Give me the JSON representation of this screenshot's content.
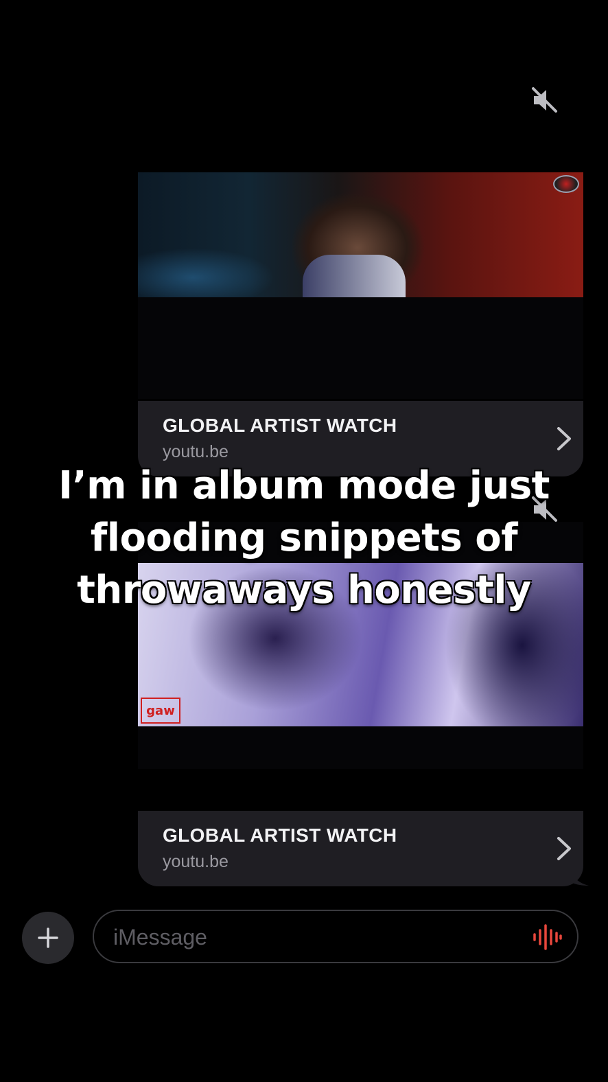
{
  "messages": [
    {
      "type": "link-preview",
      "title": "GLOBAL ARTIST WATCH",
      "domain": "youtu.be",
      "muted": true
    },
    {
      "type": "link-preview",
      "title": "GLOBAL ARTIST WATCH",
      "domain": "youtu.be",
      "muted": true,
      "watermark": "gaw"
    }
  ],
  "caption": "I’m in album mode just\nflooding snippets of\nthrowaways honestly",
  "composer": {
    "placeholder": "iMessage"
  },
  "colors": {
    "background": "#000000",
    "bubble": "#1f1e23",
    "voice_accent": "#e8473c"
  },
  "icons": {
    "mute": "speaker-muted-icon",
    "chevron": "chevron-right-icon",
    "plus": "plus-icon",
    "voice": "waveform-icon"
  }
}
